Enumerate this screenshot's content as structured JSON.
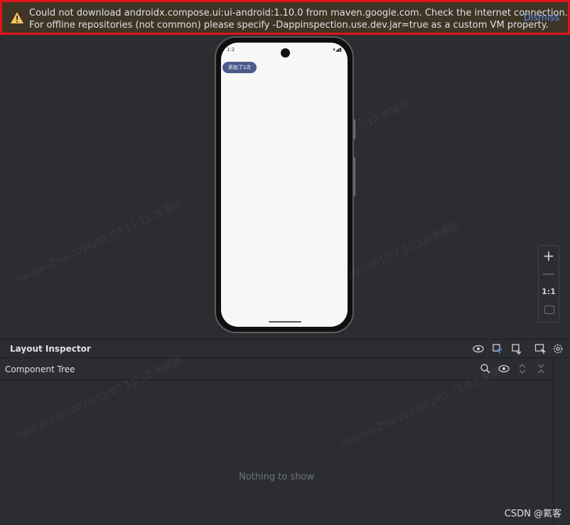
{
  "banner": {
    "line1": "Could not download androidx.compose.ui:ui-android:1.10.0 from maven.google.com. Check the internet connection.",
    "line2": "For offline repositories (not common) please specify -Dappinspection.use.dev.jar=true as a custom VM property.",
    "dismiss": "Dismiss",
    "icon": "warning-icon"
  },
  "device": {
    "time": "1:2",
    "app_button": "添加了1次"
  },
  "zoom": {
    "plus": "+",
    "minus": "—",
    "one_to_one": "1:1"
  },
  "layout_inspector": {
    "title": "Layout Inspector"
  },
  "component_tree": {
    "title": "Component Tree",
    "empty": "Nothing to show"
  },
  "watermark": {
    "text": "Haokai.Zhu-2026/01/07  11:12-朱豪凯"
  },
  "footer": {
    "csdn": "CSDN @氦客"
  }
}
